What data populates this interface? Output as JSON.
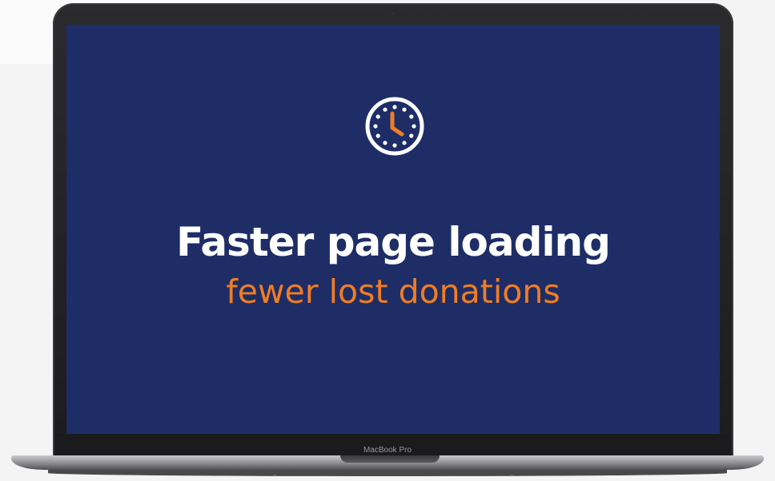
{
  "screen": {
    "icon": "clock-icon",
    "headline": "Faster page loading",
    "subline": "fewer lost donations"
  },
  "device": {
    "model_label": "MacBook Pro"
  },
  "colors": {
    "screen_background": "#1e2d66",
    "headline": "#ffffff",
    "accent": "#f07d23",
    "icon_stroke": "#ffffff"
  }
}
